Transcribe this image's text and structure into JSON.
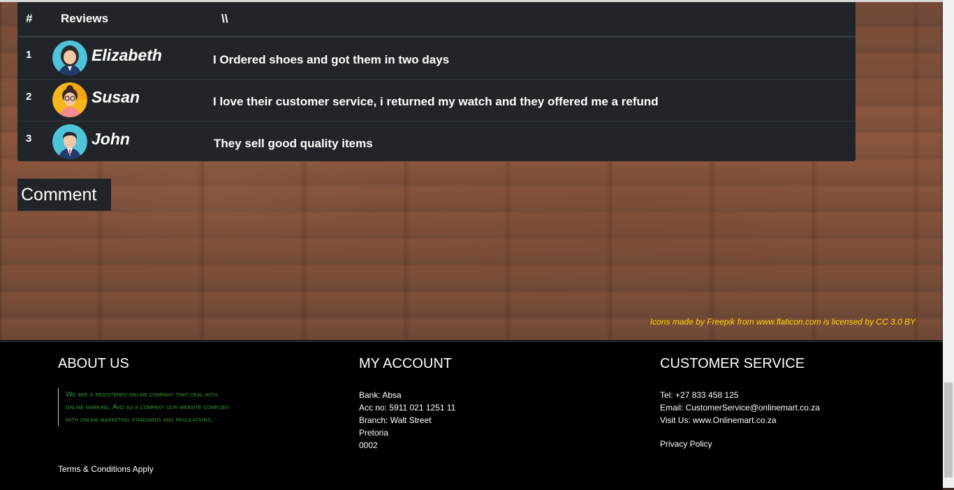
{
  "table": {
    "headers": [
      "#",
      "Reviews",
      "\\\\"
    ],
    "rows": [
      {
        "num": "1",
        "name": "Elizabeth",
        "text": "I Ordered shoes and got them in two days"
      },
      {
        "num": "2",
        "name": "Susan",
        "text": "I love their customer service, i returned my watch and they offered me a refund"
      },
      {
        "num": "3",
        "name": "John",
        "text": "They sell good quality items"
      }
    ]
  },
  "comment_label": "Comment",
  "credits": "Icons made by Freepik from www.flaticon.com is licensed by CC 3.0 BY",
  "footer": {
    "about": {
      "title": "ABOUT US",
      "text": "We are a registered online company that deal with online marking, And as a company our website complies with online marketing standards and regulations,",
      "terms": "Terms & Conditions Apply"
    },
    "account": {
      "title": "MY ACCOUNT",
      "lines": [
        "Bank: Absa",
        "Acc no: 5911 021 1251 11",
        "Branch: Walt Street",
        "Pretoria",
        "0002"
      ]
    },
    "service": {
      "title": "CUSTOMER SERVICE",
      "lines": [
        "Tel: +27 833 458 125",
        "Email: CustomerService@onlinemart.co.za",
        "Visit Us: www.Onlinemart.co.za"
      ],
      "privacy": "Privacy Policy"
    }
  },
  "colors": {
    "table_bg": "#212529",
    "credits": "#ffd700",
    "about_text": "#3a9b3a"
  },
  "icons": [
    "avatar-woman-icon",
    "avatar-woman-glasses-icon",
    "avatar-man-icon"
  ]
}
